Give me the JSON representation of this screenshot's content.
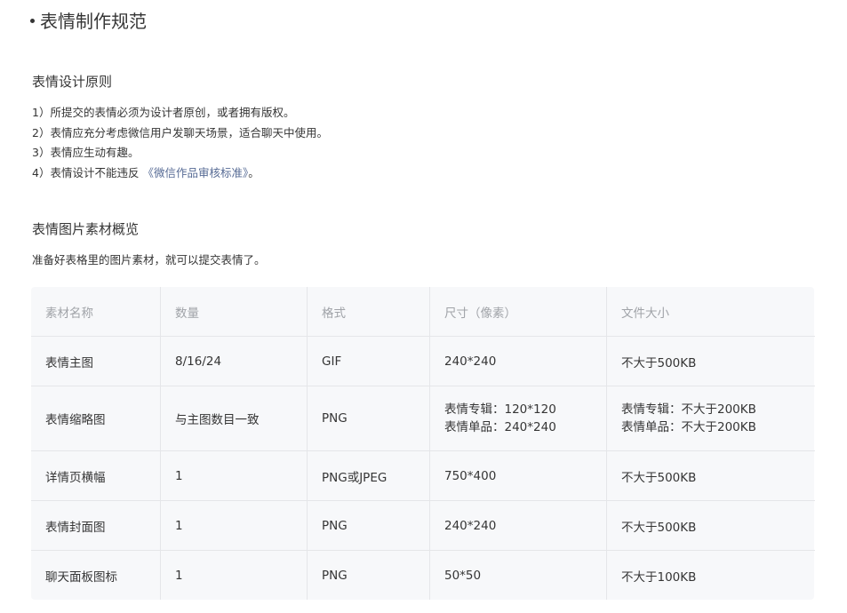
{
  "main_title": "表情制作规范",
  "design_principles": {
    "title": "表情设计原则",
    "rules": [
      "1）所提交的表情必须为设计者原创，或者拥有版权。",
      "2）表情应充分考虑微信用户发聊天场景，适合聊天中使用。",
      "3）表情应生动有趣。"
    ],
    "rule4_prefix": "4）表情设计不能违反",
    "rule4_link": "《微信作品审核标准》",
    "rule4_suffix": "。"
  },
  "materials": {
    "title": "表情图片素材概览",
    "intro": "准备好表格里的图片素材，就可以提交表情了。",
    "headers": [
      "素材名称",
      "数量",
      "格式",
      "尺寸（像素）",
      "文件大小"
    ],
    "rows": [
      {
        "name": "表情主图",
        "count": "8/16/24",
        "format": "GIF",
        "size": [
          "240*240"
        ],
        "filesize": [
          "不大于500KB"
        ]
      },
      {
        "name": "表情缩略图",
        "count": "与主图数目一致",
        "format": "PNG",
        "size": [
          "表情专辑：120*120",
          "表情单品：240*240"
        ],
        "filesize": [
          "表情专辑：不大于200KB",
          "表情单品：不大于200KB"
        ]
      },
      {
        "name": "详情页横幅",
        "count": "1",
        "format": "PNG或JPEG",
        "size": [
          "750*400"
        ],
        "filesize": [
          "不大于500KB"
        ]
      },
      {
        "name": "表情封面图",
        "count": "1",
        "format": "PNG",
        "size": [
          "240*240"
        ],
        "filesize": [
          "不大于500KB"
        ]
      },
      {
        "name": "聊天面板图标",
        "count": "1",
        "format": "PNG",
        "size": [
          "50*50"
        ],
        "filesize": [
          "不大于100KB"
        ]
      }
    ]
  }
}
